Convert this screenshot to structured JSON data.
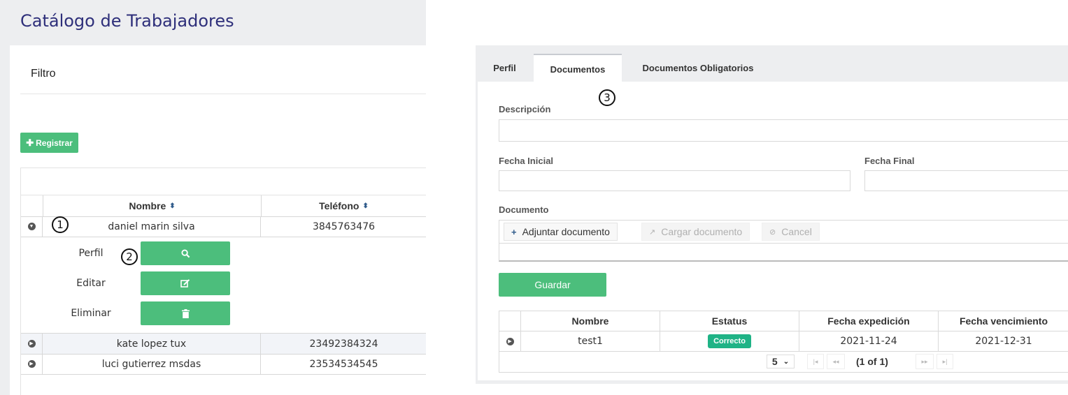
{
  "left": {
    "title": "Catálogo de Trabajadores",
    "filter_label": "Filtro",
    "register_button": "Registrar",
    "register_icon": "plus-icon",
    "columns": {
      "nombre": "Nombre",
      "telefono": "Teléfono"
    },
    "rows": [
      {
        "nombre": "daniel marin silva",
        "telefono": "3845763476",
        "expanded": true
      },
      {
        "nombre": "kate lopez tux",
        "telefono": "23492384324",
        "expanded": false
      },
      {
        "nombre": "luci gutierrez msdas",
        "telefono": "23534534545",
        "expanded": false
      }
    ],
    "detail_actions": [
      {
        "label": "Perfil",
        "icon": "search-icon"
      },
      {
        "label": "Editar",
        "icon": "edit-icon"
      },
      {
        "label": "Eliminar",
        "icon": "trash-icon"
      }
    ],
    "markers": [
      "1",
      "2"
    ]
  },
  "right": {
    "tabs": [
      {
        "label": "Perfil",
        "active": false
      },
      {
        "label": "Documentos",
        "active": true
      },
      {
        "label": "Documentos Obligatorios",
        "active": false
      }
    ],
    "marker": "3",
    "form": {
      "descripcion_label": "Descripción",
      "descripcion_value": "",
      "fecha_inicial_label": "Fecha Inicial",
      "fecha_inicial_value": "",
      "fecha_final_label": "Fecha Final",
      "fecha_final_value": "",
      "documento_label": "Documento"
    },
    "upload": {
      "choose": "Adjuntar documento",
      "upload": "Cargar documento",
      "cancel": "Cancel"
    },
    "save_button": "Guardar",
    "table": {
      "columns": [
        "Nombre",
        "Estatus",
        "Fecha expedición",
        "Fecha vencimiento"
      ],
      "rows": [
        {
          "nombre": "test1",
          "estatus": "Correcto",
          "expedicion": "2021-11-24",
          "vencimiento": "2021-12-31"
        }
      ]
    },
    "pager": {
      "rows_per_page": "5",
      "report": "(1 of 1)"
    }
  },
  "colors": {
    "accent": "#4cbe7c",
    "title": "#2e2f7a",
    "badge": "#1fb386"
  }
}
